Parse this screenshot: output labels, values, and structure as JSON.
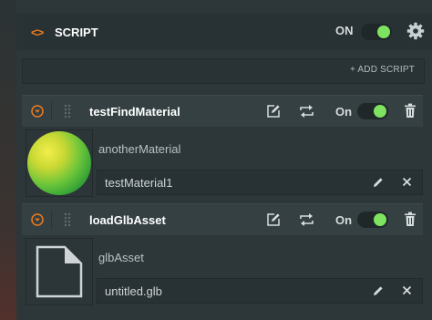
{
  "script_header": {
    "code_icon": "<>",
    "title": "SCRIPT",
    "on_label": "ON",
    "enabled": true
  },
  "add_script_label": "+ ADD SCRIPT",
  "entries": [
    {
      "name": "testFindMaterial",
      "on_label": "On",
      "enabled": true,
      "attribute": {
        "label": "anotherMaterial",
        "value": "testMaterial1",
        "thumbnail": "material-sphere"
      }
    },
    {
      "name": "loadGlbAsset",
      "on_label": "On",
      "enabled": true,
      "attribute": {
        "label": "glbAsset",
        "value": "untitled.glb",
        "thumbnail": "file-icon"
      }
    }
  ],
  "colors": {
    "accent": "#f07b1e",
    "toggle_on": "#7ee360",
    "panel": "#2d3638"
  }
}
